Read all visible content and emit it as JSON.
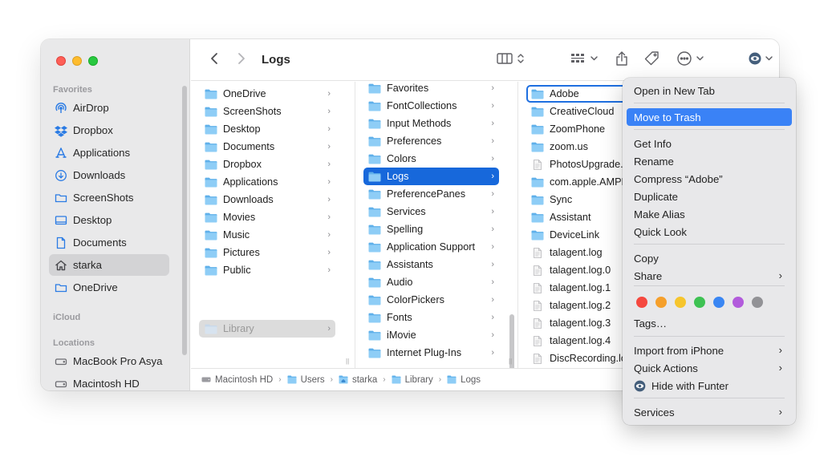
{
  "sidebar": {
    "sections": {
      "favorites": "Favorites",
      "icloud": "iCloud",
      "locations": "Locations"
    },
    "items": [
      {
        "label": "AirDrop",
        "icon": "airdrop-icon"
      },
      {
        "label": "Dropbox",
        "icon": "dropbox-icon"
      },
      {
        "label": "Applications",
        "icon": "applications-icon"
      },
      {
        "label": "Downloads",
        "icon": "downloads-icon"
      },
      {
        "label": "ScreenShots",
        "icon": "folder-icon"
      },
      {
        "label": "Desktop",
        "icon": "desktop-icon"
      },
      {
        "label": "Documents",
        "icon": "document-icon"
      },
      {
        "label": "starka",
        "icon": "home-icon",
        "selected": true
      },
      {
        "label": "OneDrive",
        "icon": "folder-icon"
      }
    ],
    "locations": [
      {
        "label": "MacBook Pro Asya",
        "icon": "drive-icon"
      },
      {
        "label": "Macintosh HD",
        "icon": "drive-icon"
      }
    ]
  },
  "toolbar": {
    "title": "Logs",
    "icons": [
      "back-icon",
      "forward-icon",
      "column-view-icon",
      "group-icon",
      "share-icon",
      "tag-icon",
      "more-icon",
      "funter-icon",
      "search-icon"
    ]
  },
  "columns": {
    "col1": [
      "OneDrive",
      "ScreenShots",
      "Desktop",
      "Documents",
      "Dropbox",
      "Applications",
      "Downloads",
      "Movies",
      "Music",
      "Pictures",
      "Public",
      "Library"
    ],
    "col2": [
      "Favorites",
      "FontCollections",
      "Input Methods",
      "Preferences",
      "Colors",
      "Logs",
      "PreferencePanes",
      "Services",
      "Spelling",
      "Application Support",
      "Assistants",
      "Audio",
      "ColorPickers",
      "Fonts",
      "iMovie",
      "Internet Plug-Ins"
    ],
    "col3": [
      {
        "label": "Adobe",
        "type": "folder"
      },
      {
        "label": "CreativeCloud",
        "type": "folder"
      },
      {
        "label": "ZoomPhone",
        "type": "folder"
      },
      {
        "label": "zoom.us",
        "type": "folder"
      },
      {
        "label": "PhotosUpgrade.l",
        "type": "file"
      },
      {
        "label": "com.apple.AMPL",
        "type": "folder"
      },
      {
        "label": "Sync",
        "type": "folder"
      },
      {
        "label": "Assistant",
        "type": "folder"
      },
      {
        "label": "DeviceLink",
        "type": "folder"
      },
      {
        "label": "talagent.log",
        "type": "file"
      },
      {
        "label": "talagent.log.0",
        "type": "file"
      },
      {
        "label": "talagent.log.1",
        "type": "file"
      },
      {
        "label": "talagent.log.2",
        "type": "file"
      },
      {
        "label": "talagent.log.3",
        "type": "file"
      },
      {
        "label": "talagent.log.4",
        "type": "file"
      },
      {
        "label": "DiscRecording.lo",
        "type": "file"
      }
    ]
  },
  "pathbar": [
    "Macintosh HD",
    "Users",
    "starka",
    "Library",
    "Logs"
  ],
  "context_menu": {
    "items": [
      {
        "label": "Open in New Tab"
      },
      {
        "label": "Move to Trash",
        "highlighted": true
      },
      {
        "label": "Get Info"
      },
      {
        "label": "Rename"
      },
      {
        "label": "Compress “Adobe”"
      },
      {
        "label": "Duplicate"
      },
      {
        "label": "Make Alias"
      },
      {
        "label": "Quick Look"
      },
      {
        "label": "Copy"
      },
      {
        "label": "Share",
        "submenu": true
      },
      {
        "label": "Tags…"
      },
      {
        "label": "Import from iPhone",
        "submenu": true
      },
      {
        "label": "Quick Actions",
        "submenu": true
      },
      {
        "label": "Hide with Funter",
        "icon": "funter-icon"
      },
      {
        "label": "Services",
        "submenu": true
      }
    ],
    "tag_colors": [
      "#f5483f",
      "#f5a02c",
      "#f6c52d",
      "#3ec253",
      "#3a86f3",
      "#b25bdc",
      "#929296"
    ]
  }
}
